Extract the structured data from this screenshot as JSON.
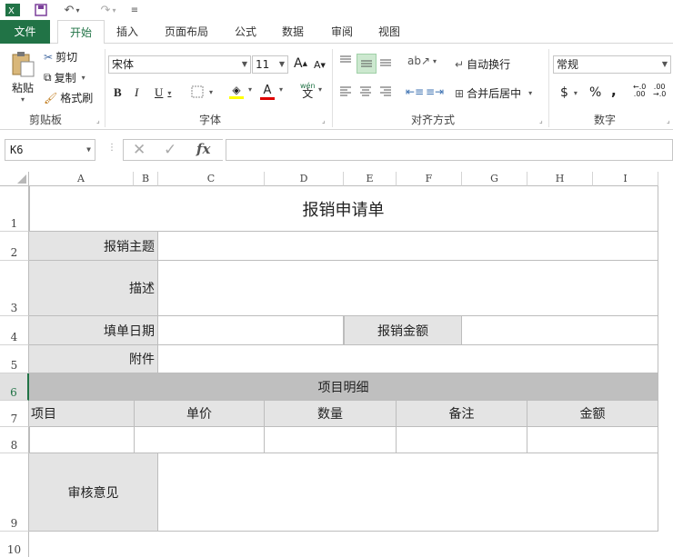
{
  "quick_access": {
    "app_icon": "excel-icon",
    "save_icon": "save-icon",
    "undo_icon": "undo-icon",
    "redo_icon": "redo-icon",
    "customize_icon": "customize-qat-icon"
  },
  "tabs": [
    {
      "label": "文件"
    },
    {
      "label": "开始"
    },
    {
      "label": "插入"
    },
    {
      "label": "页面布局"
    },
    {
      "label": "公式"
    },
    {
      "label": "数据"
    },
    {
      "label": "审阅"
    },
    {
      "label": "视图"
    }
  ],
  "ribbon": {
    "clipboard": {
      "group_label": "剪贴板",
      "paste": "粘贴",
      "cut": "剪切",
      "copy": "复制",
      "format_painter": "格式刷"
    },
    "font": {
      "group_label": "字体",
      "font_name": "宋体",
      "font_size": "11",
      "bold": "B",
      "italic": "I",
      "underline": "U",
      "grow": "A",
      "shrink": "A",
      "phonetic": "wén",
      "font_color_glyph": "A"
    },
    "alignment": {
      "group_label": "对齐方式",
      "wrap_text": "自动换行",
      "merge_center": "合并后居中"
    },
    "number": {
      "group_label": "数字",
      "format": "常规",
      "currency": "$",
      "percent": "%",
      "comma": ","
    }
  },
  "formula_bar": {
    "name_box": "K6",
    "fx": "fx",
    "formula": ""
  },
  "columns": [
    "A",
    "B",
    "C",
    "D",
    "E",
    "F",
    "G",
    "H",
    "I"
  ],
  "rows": [
    "1",
    "2",
    "3",
    "4",
    "5",
    "6",
    "7",
    "8",
    "9",
    "10"
  ],
  "sheet": {
    "title": "报销申请单",
    "subject_label": "报销主题",
    "description_label": "描述",
    "date_label": "填单日期",
    "amount_label": "报销金额",
    "attachment_label": "附件",
    "detail_header": "项目明细",
    "detail_columns": [
      "项目",
      "单价",
      "数量",
      "备注",
      "金额"
    ],
    "review_label": "审核意见"
  },
  "colors": {
    "accent": "#217346",
    "label_fill": "#e4e4e4",
    "section_fill": "#bfbfbf"
  }
}
